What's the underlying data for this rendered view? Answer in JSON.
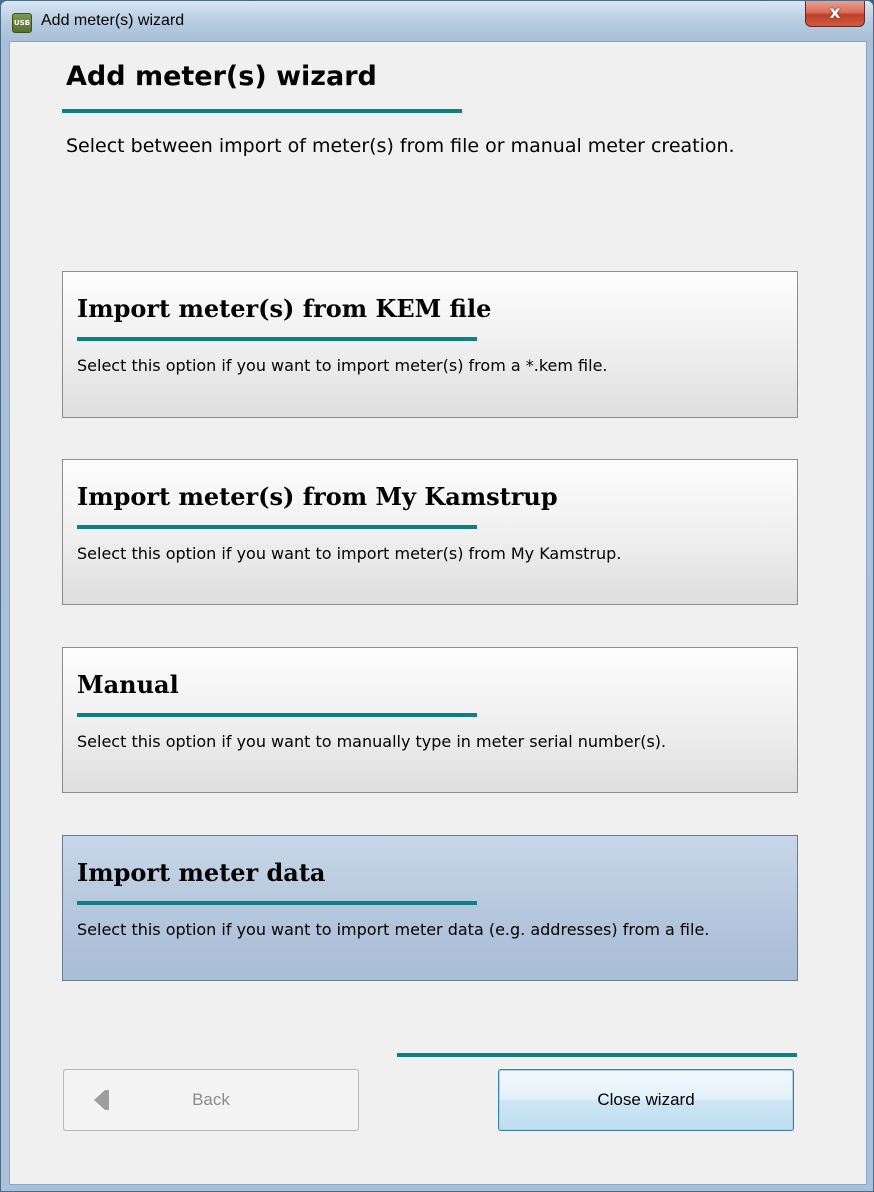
{
  "window": {
    "icon_text": "USB",
    "title": "Add meter(s) wizard",
    "close_glyph": "x"
  },
  "page": {
    "title": "Add meter(s) wizard",
    "description": "Select between import of meter(s) from file or manual meter creation."
  },
  "options": [
    {
      "title": "Import meter(s) from KEM file",
      "description": "Select this option if you want to import meter(s) from a *.kem file.",
      "selected": false
    },
    {
      "title": "Import meter(s) from My Kamstrup",
      "description": "Select this option if you want to import meter(s) from My Kamstrup.",
      "selected": false
    },
    {
      "title": "Manual",
      "description": "Select this option if you want to manually type in meter serial number(s).",
      "selected": false
    },
    {
      "title": "Import meter data",
      "description": "Select this option if you want to import meter data (e.g. addresses) from a file.",
      "selected": true
    }
  ],
  "buttons": {
    "back_label": "Back",
    "back_enabled": false,
    "close_label": "Close wizard"
  },
  "colors": {
    "accent_teal": "#127f7f",
    "selected_option_bg": "#b2c5dc",
    "close_button_red": "#c0412a"
  }
}
